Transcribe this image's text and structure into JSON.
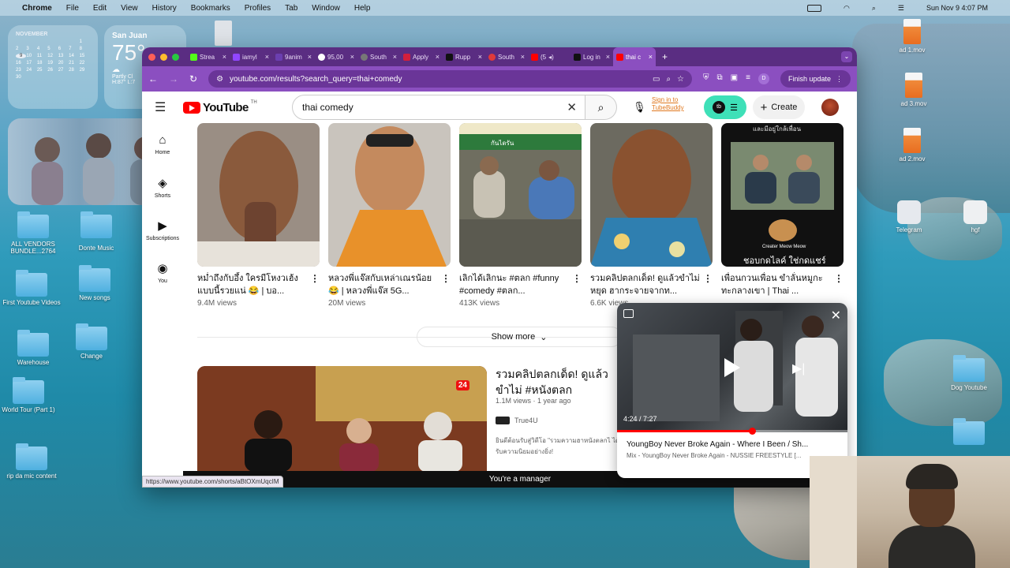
{
  "menubar": {
    "app": "Chrome",
    "items": [
      "File",
      "Edit",
      "View",
      "History",
      "Bookmarks",
      "Profiles",
      "Tab",
      "Window",
      "Help"
    ],
    "datetime": "Sun Nov 9  4:07 PM"
  },
  "widgets": {
    "calendar": {
      "month": "NOVEMBER",
      "days": [
        "",
        "",
        "",
        "",
        "",
        "",
        "1",
        "2",
        "3",
        "4",
        "5",
        "6",
        "7",
        "8",
        "9",
        "10",
        "11",
        "12",
        "13",
        "14",
        "15",
        "16",
        "17",
        "18",
        "19",
        "20",
        "21",
        "22",
        "23",
        "24",
        "25",
        "26",
        "27",
        "28",
        "29",
        "30"
      ]
    },
    "weather": {
      "city": "San Juan",
      "temp": "75°",
      "desc": "Partly Cl",
      "hl": "H:87° L:7"
    }
  },
  "desktop_icons": {
    "left": [
      {
        "label": "ALL VENDORS BUNDLE...2764"
      },
      {
        "label": "Donte Music"
      },
      {
        "label": "First Youtube Videos"
      },
      {
        "label": "New songs"
      },
      {
        "label": "Warehouse"
      },
      {
        "label": "Change"
      },
      {
        "label": "World Tour (Part 1)"
      },
      {
        "label": "rip da mic content"
      }
    ],
    "right": [
      {
        "label": "ad 1.mov"
      },
      {
        "label": "ad 3.mov"
      },
      {
        "label": "ad 2.mov"
      },
      {
        "label": "Telegram"
      },
      {
        "label": "hgf"
      },
      {
        "label": "Dog Youtube"
      }
    ]
  },
  "browser": {
    "tabs": [
      {
        "label": "Strea"
      },
      {
        "label": "iamyl"
      },
      {
        "label": "9anim"
      },
      {
        "label": "95,00"
      },
      {
        "label": "South"
      },
      {
        "label": "Apply"
      },
      {
        "label": "Rupp"
      },
      {
        "label": "South"
      },
      {
        "label": "(5"
      },
      {
        "label": "Log in"
      },
      {
        "label": "thai c"
      }
    ],
    "url": "youtube.com/results?search_query=thai+comedy",
    "profile_letter": "D",
    "finish_update": "Finish update"
  },
  "youtube": {
    "logo": "YouTube",
    "country": "TH",
    "search_value": "thai comedy",
    "tubebuddy": "Sign in to TubeBuddy",
    "tb_badge": "tb",
    "create": "Create",
    "sidebar": [
      {
        "label": "Home"
      },
      {
        "label": "Shorts"
      },
      {
        "label": "Subscriptions"
      },
      {
        "label": "You"
      }
    ],
    "shorts": [
      {
        "title": "หม่ำถึงกับอึ้ง ใครมีโหงวเฮ้งแบบนี้รวยแน่ 😂 | บอ...",
        "views": "9.4M views"
      },
      {
        "title": "หลวงพี่แจ๊สกับเหล่าเณรน้อย 😂 | หลวงพี่แจ๊ส 5G...",
        "views": "20M views"
      },
      {
        "title": "เลิกได้เลิกนะ #ตลก #funny #comedy #ตลก...",
        "views": "413K views"
      },
      {
        "title": "รวมคลิปตลกเด็ด! ดูแล้วขำไม่หยุด ฮากระจายจากท...",
        "views": "6.6K views"
      },
      {
        "title": "เพื่อนกวนเพื่อน ขำลั่นหมูกะทะกลางเขา | Thai ...",
        "views": ""
      }
    ],
    "show_more": "Show more",
    "result": {
      "title": "รวมคลิปตลกเด็ด! ดูแล้วขำไม่ #หนังตลก",
      "meta": "1.1M views · 1 year ago",
      "channel": "True4U",
      "desc": "ยินดีต้อนรับสู่วิดีโอ \"รวมความฮาหนังตลกไ ได้รับความนิยมอย่างยิ่ง!",
      "badge": "24"
    },
    "status_url": "https://www.youtube.com/shorts/aBtOXmUqcIM",
    "manager_banner": "You're a manager",
    "thumb_captions": {
      "t5_bottom": "ชอบกดไลค์ ใช่กดแชร์",
      "t5_top": "และมีอยู่ใกล้เพื่อน",
      "logo": "Creater Meow Meow",
      "t2_sign": "กันไดรัน"
    }
  },
  "miniplayer": {
    "time": "4:24 / 7:27",
    "progress": 0.59,
    "title": "YoungBoy Never Broke Again - Where I Been / Sh...",
    "subtitle": "Mix - YoungBoy Never Broke Again - NUSSIE FREESTYLE [..."
  },
  "colors": {
    "tabbar": "#5a2d82",
    "addrbar": "#8b4fc0",
    "yt_red": "#ff0000",
    "tubebuddy": "#3ee0b8"
  }
}
